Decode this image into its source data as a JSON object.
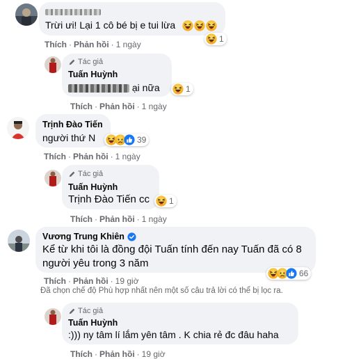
{
  "actions": {
    "like": "Thích",
    "reply": "Phản hồi",
    "separator": "·"
  },
  "author_tag": "Tác giả",
  "comments": [
    {
      "id": "c1",
      "name": "",
      "text": "Trừi ưi! Lại 1 cô bé bị e tui lừa",
      "time": "1 ngày",
      "reaction_count": "1"
    },
    {
      "id": "r1",
      "name": "Tuấn Huỳnh",
      "text": "ại nữa",
      "time": "1 ngày",
      "reaction_count": "1"
    },
    {
      "id": "c2",
      "name": "Trịnh Đào Tiến",
      "text": "người thứ N",
      "time": "1 ngày",
      "reaction_count": "39"
    },
    {
      "id": "r2",
      "name": "Tuấn Huỳnh",
      "text": "Trịnh Đào Tiến cc",
      "time": "1 ngày",
      "reaction_count": "1"
    },
    {
      "id": "c3",
      "name": "Vương Trung Khiên",
      "verified": true,
      "text": "Kể từ khi tôi là đồng đội Tuấn tính đến nay Tuấn đã có 8 người yêu trong 3 năm",
      "time": "19 giờ",
      "reaction_count": "66"
    },
    {
      "id": "r3",
      "name": "Tuấn Huỳnh",
      "text": ":))) ny tâm lí lắm yên tâm . K chia rẻ đc đâu haha",
      "time": "19 giờ"
    }
  ],
  "filter_notice": "Đã chọn chế độ Phù hợp nhất nên một số câu trả lời có thể bị lọc ra.",
  "colors": {
    "bubble": "#f0f2f5",
    "meta": "#65676b",
    "verified": "#1877f2",
    "haha": "#f7b125"
  },
  "icons": [
    "haha-emoji",
    "sad-emoji",
    "like-emoji",
    "pencil-author-icon",
    "verified-badge-icon"
  ]
}
